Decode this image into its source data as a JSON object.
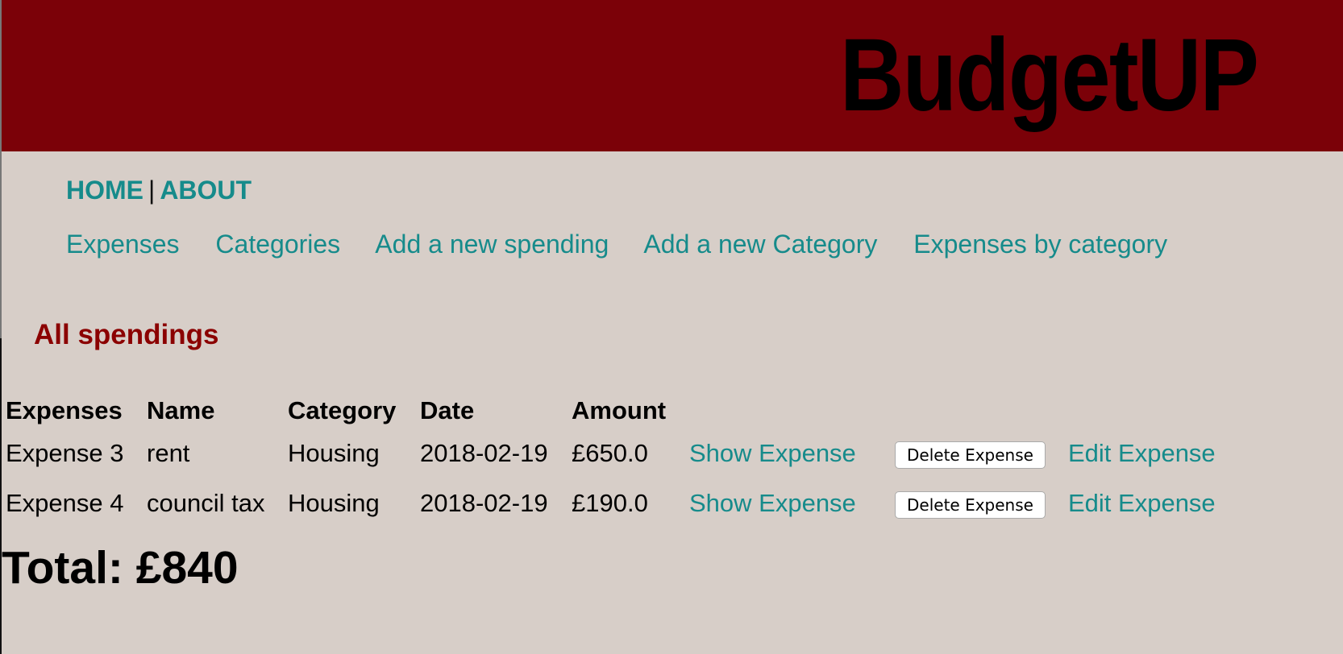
{
  "brand": {
    "title": "BudgetUP"
  },
  "topnav": {
    "home": "HOME",
    "separator": "|",
    "about": "ABOUT"
  },
  "subnav": {
    "items": [
      {
        "label": "Expenses"
      },
      {
        "label": "Categories"
      },
      {
        "label": "Add a new spending"
      },
      {
        "label": "Add a new Category"
      },
      {
        "label": "Expenses by category"
      }
    ]
  },
  "main": {
    "title": "All spendings",
    "table": {
      "headers": [
        "Expenses",
        "Name",
        "Category",
        "Date",
        "Amount"
      ],
      "rows": [
        {
          "expense": "Expense 3",
          "name": "rent",
          "category": "Housing",
          "date": "2018-02-19",
          "amount": "£650.0",
          "show_label": "Show Expense",
          "delete_label": "Delete Expense",
          "edit_label": "Edit Expense"
        },
        {
          "expense": "Expense 4",
          "name": "council tax",
          "category": "Housing",
          "date": "2018-02-19",
          "amount": "£190.0",
          "show_label": "Show Expense",
          "delete_label": "Delete Expense",
          "edit_label": "Edit Expense"
        }
      ]
    },
    "total": "Total: £840"
  },
  "colors": {
    "header_bg": "#7b0108",
    "page_bg": "#d7cec8",
    "link": "#168b8b",
    "title": "#8b0000"
  }
}
